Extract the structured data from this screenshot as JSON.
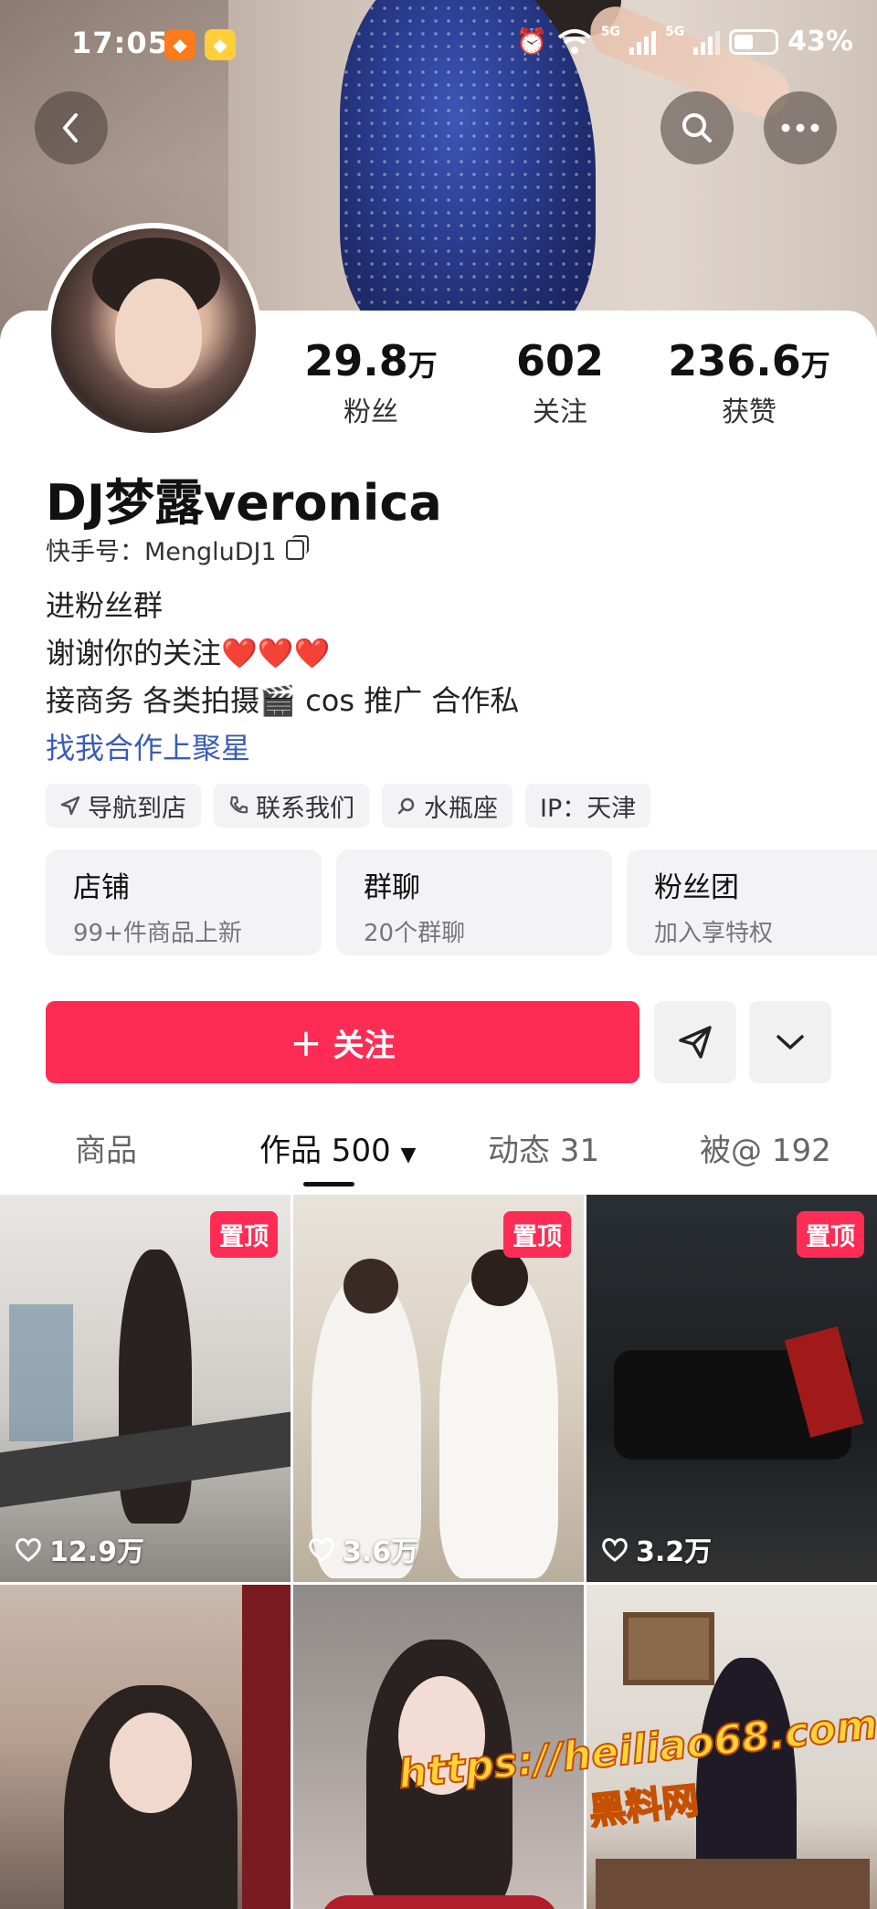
{
  "status_bar": {
    "time": "17:05",
    "network_a": "5G",
    "network_b": "5G",
    "battery": "43%"
  },
  "profile": {
    "stats": [
      {
        "num": "29.8",
        "unit": "万",
        "label": "粉丝"
      },
      {
        "num": "602",
        "unit": "",
        "label": "关注"
      },
      {
        "num": "236.6",
        "unit": "万",
        "label": "获赞"
      }
    ],
    "name": "DJ梦露veronica",
    "kuaishou_id": "快手号：MengluDJ1",
    "bio": {
      "line1": "进粉丝群",
      "line2": "谢谢你的关注",
      "line2_hearts": "❤️❤️❤️",
      "line3": "接商务 各类拍摄🎬 cos 推广 合作私",
      "link": "找我合作上聚星"
    },
    "chips": [
      {
        "icon": "navigate-icon",
        "label": "导航到店"
      },
      {
        "icon": "phone-icon",
        "label": "联系我们"
      },
      {
        "icon": "search-icon",
        "label": "水瓶座"
      },
      {
        "icon": "",
        "label": "IP：天津"
      }
    ],
    "cards": [
      {
        "title": "店铺",
        "sub": "99+件商品上新"
      },
      {
        "title": "群聊",
        "sub": "20个群聊"
      },
      {
        "title": "粉丝团",
        "sub": "加入享特权"
      }
    ],
    "follow_label": "关注",
    "follow_plus": "+"
  },
  "tabs": [
    {
      "label": "商品"
    },
    {
      "label": "作品 500"
    },
    {
      "label": "动态 31"
    },
    {
      "label": "被@ 192"
    }
  ],
  "grid": [
    {
      "pinned": "置顶",
      "likes": "12.9万"
    },
    {
      "pinned": "置顶",
      "likes": "3.6万"
    },
    {
      "pinned": "置顶",
      "likes": "3.2万"
    },
    {
      "pinned": "",
      "likes": ""
    },
    {
      "pinned": "",
      "likes": ""
    },
    {
      "pinned": "",
      "likes": ""
    }
  ],
  "watermark": {
    "url": "https://heiliao68.com",
    "name": "黑料网"
  },
  "colors": {
    "accent": "#fe2c55",
    "link": "#3b5bb5"
  }
}
